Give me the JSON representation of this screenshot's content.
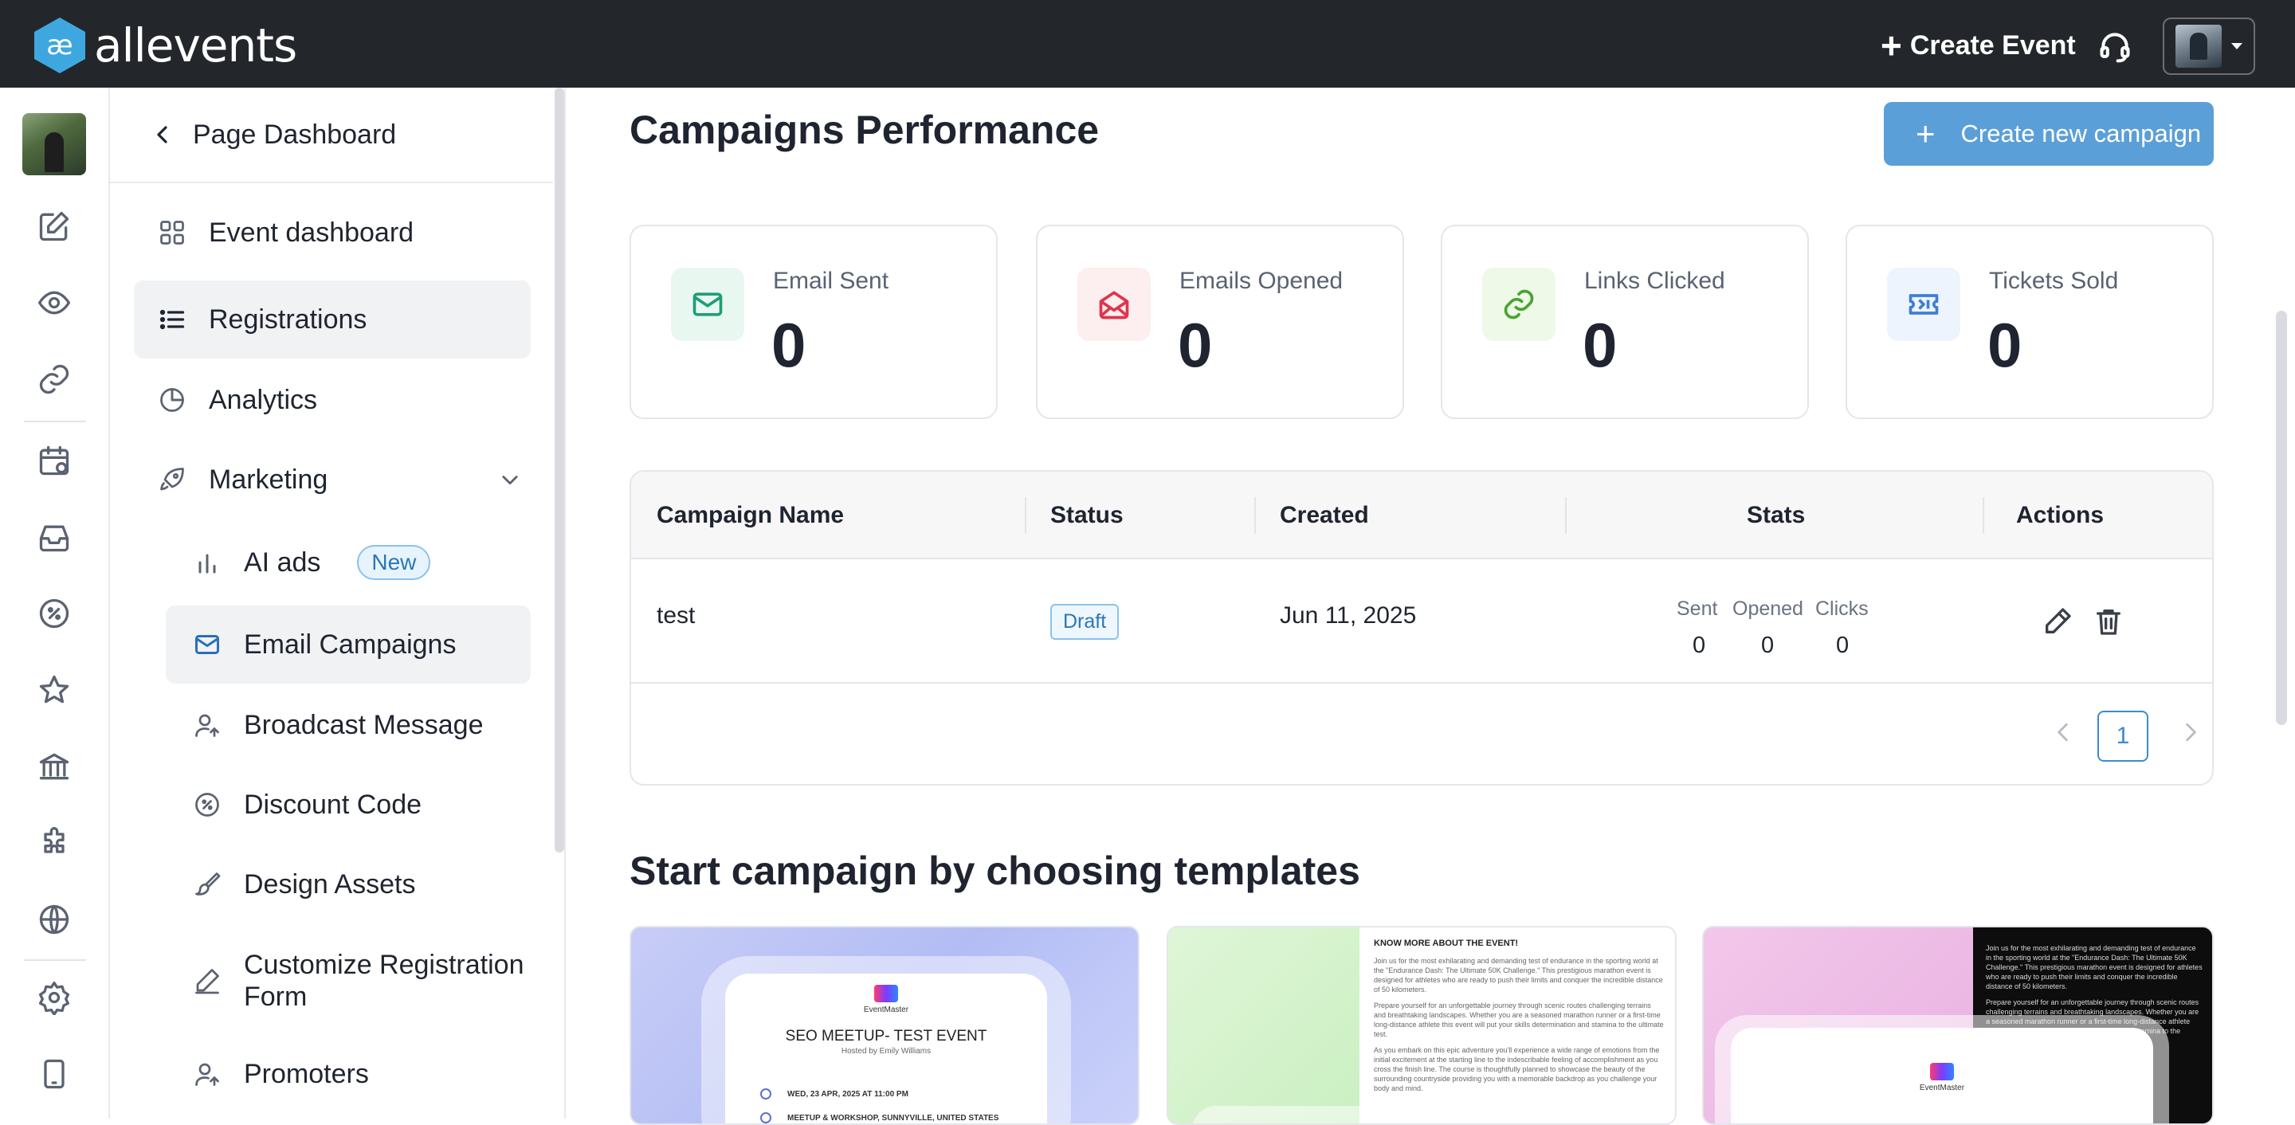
{
  "header": {
    "logo_text": "allevents",
    "create_event_label": "Create Event"
  },
  "rail": {
    "icons": [
      "edit-icon",
      "eye-icon",
      "link-icon",
      "calendar-icon",
      "inbox-icon",
      "discount-icon",
      "star-icon",
      "bank-icon",
      "puzzle-icon",
      "globe-icon",
      "settings-icon",
      "mobile-icon"
    ]
  },
  "sidebar": {
    "back_label": "Page Dashboard",
    "items": {
      "event_dashboard": "Event dashboard",
      "registrations": "Registrations",
      "analytics": "Analytics",
      "marketing": "Marketing",
      "ai_ads": "AI ads",
      "ai_ads_badge": "New",
      "email_campaigns": "Email Campaigns",
      "broadcast_message": "Broadcast Message",
      "discount_code": "Discount Code",
      "design_assets": "Design Assets",
      "customize_registration_form": "Customize Registration Form",
      "promoters": "Promoters"
    }
  },
  "main": {
    "title": "Campaigns Performance",
    "create_campaign_label": "Create new campaign",
    "stats": [
      {
        "label": "Email Sent",
        "value": "0",
        "icon": "mail-icon",
        "color": "#1e9e78"
      },
      {
        "label": "Emails Opened",
        "value": "0",
        "icon": "mail-open-icon",
        "color": "#e0344a"
      },
      {
        "label": "Links Clicked",
        "value": "0",
        "icon": "link-icon",
        "color": "#4aa331"
      },
      {
        "label": "Tickets Sold",
        "value": "0",
        "icon": "ticket-icon",
        "color": "#3d7fd6"
      }
    ],
    "table": {
      "headers": {
        "name": "Campaign Name",
        "status": "Status",
        "created": "Created",
        "stats": "Stats",
        "actions": "Actions"
      },
      "rows": [
        {
          "name": "test",
          "status": "Draft",
          "created": "Jun 11, 2025",
          "sent_label": "Sent",
          "opened_label": "Opened",
          "clicks_label": "Clicks",
          "sent": "0",
          "opened": "0",
          "clicks": "0"
        }
      ],
      "pagination": {
        "current_page": "1"
      }
    },
    "templates_title": "Start campaign by choosing templates",
    "templates": [
      {
        "brand": "EventMaster",
        "title": "SEO MEETUP- TEST EVENT",
        "host": "Hosted by Emily Williams",
        "date": "WED, 23 APR, 2025 AT 11:00 PM",
        "location": "MEETUP & WORKSHOP, SUNNYVILLE, UNITED STATES"
      },
      {
        "heading": "KNOW MORE ABOUT THE EVENT!",
        "para1": "Join us for the most exhilarating and demanding test of endurance in the sporting world at the \"Endurance Dash: The Ultimate 50K Challenge.\" This prestigious marathon event is designed for athletes who are ready to push their limits and conquer the incredible distance of 50 kilometers.",
        "para2": "Prepare yourself for an unforgettable journey through scenic routes challenging terrains and breathtaking landscapes. Whether you are a seasoned marathon runner or a first-time long-distance athlete this event will put your skills determination and stamina to the ultimate test.",
        "para3": "As you embark on this epic adventure you'll experience a wide range of emotions from the initial excitement at the starting line to the indescribable feeling of accomplishment as you cross the finish line. The course is thoughtfully planned to showcase the beauty of the surrounding countryside providing you with a memorable backdrop as you challenge your body and mind."
      },
      {
        "brand": "EventMaster",
        "para1": "Join us for the most exhilarating and demanding test of endurance in the sporting world at the \"Endurance Dash: The Ultimate 50K Challenge.\" This prestigious marathon event is designed for athletes who are ready to push their limits and conquer the incredible distance of 50 kilometers.",
        "para2": "Prepare yourself for an unforgettable journey through scenic routes challenging terrains and breathtaking landscapes. Whether you are a seasoned marathon runner or a first-time long-distance athlete this event will put your skills determination and stamina to the ultimate test."
      }
    ]
  }
}
